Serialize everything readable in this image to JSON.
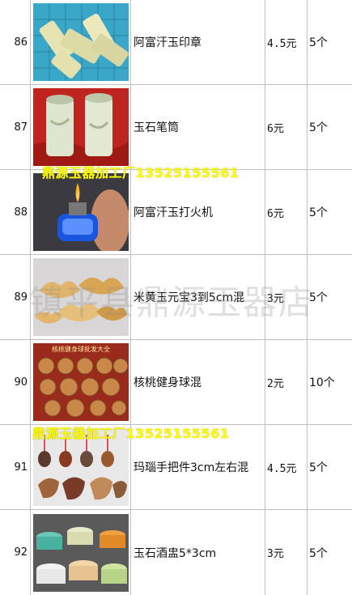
{
  "rows": [
    {
      "num": "86",
      "name": "阿富汗玉印章",
      "price": "4.5元",
      "qty": "5个",
      "image": "jade-seal-blocks"
    },
    {
      "num": "87",
      "name": "玉石笔筒",
      "price": "6元",
      "qty": "5个",
      "image": "jade-pen-holders"
    },
    {
      "num": "88",
      "name": "阿富汗玉打火机",
      "price": "6元",
      "qty": "5个",
      "image": "jade-lighter"
    },
    {
      "num": "89",
      "name": "米黄玉元宝3到5cm混",
      "price": "3元",
      "qty": "5个",
      "image": "yellow-jade-ingots"
    },
    {
      "num": "90",
      "name": "核桃健身球混",
      "price": "2元",
      "qty": "10个",
      "image": "walnut-balls"
    },
    {
      "num": "91",
      "name": "玛瑙手把件3cm左右混",
      "price": "4.5元",
      "qty": "5个",
      "image": "agate-handpieces"
    },
    {
      "num": "92",
      "name": "玉石酒盅5*3cm",
      "price": "3元",
      "qty": "5个",
      "image": "jade-wine-cups"
    }
  ],
  "banners": {
    "top": "鼎源玉器加工厂13525155561",
    "bottom": "鼎源玉器加工厂13525155561"
  },
  "watermark": "镇平县鼎源玉器店",
  "walnut_caption": "核桃健身球批发大全",
  "colors": {
    "banner": "#ffff00",
    "grid": "#bfbfbf"
  }
}
